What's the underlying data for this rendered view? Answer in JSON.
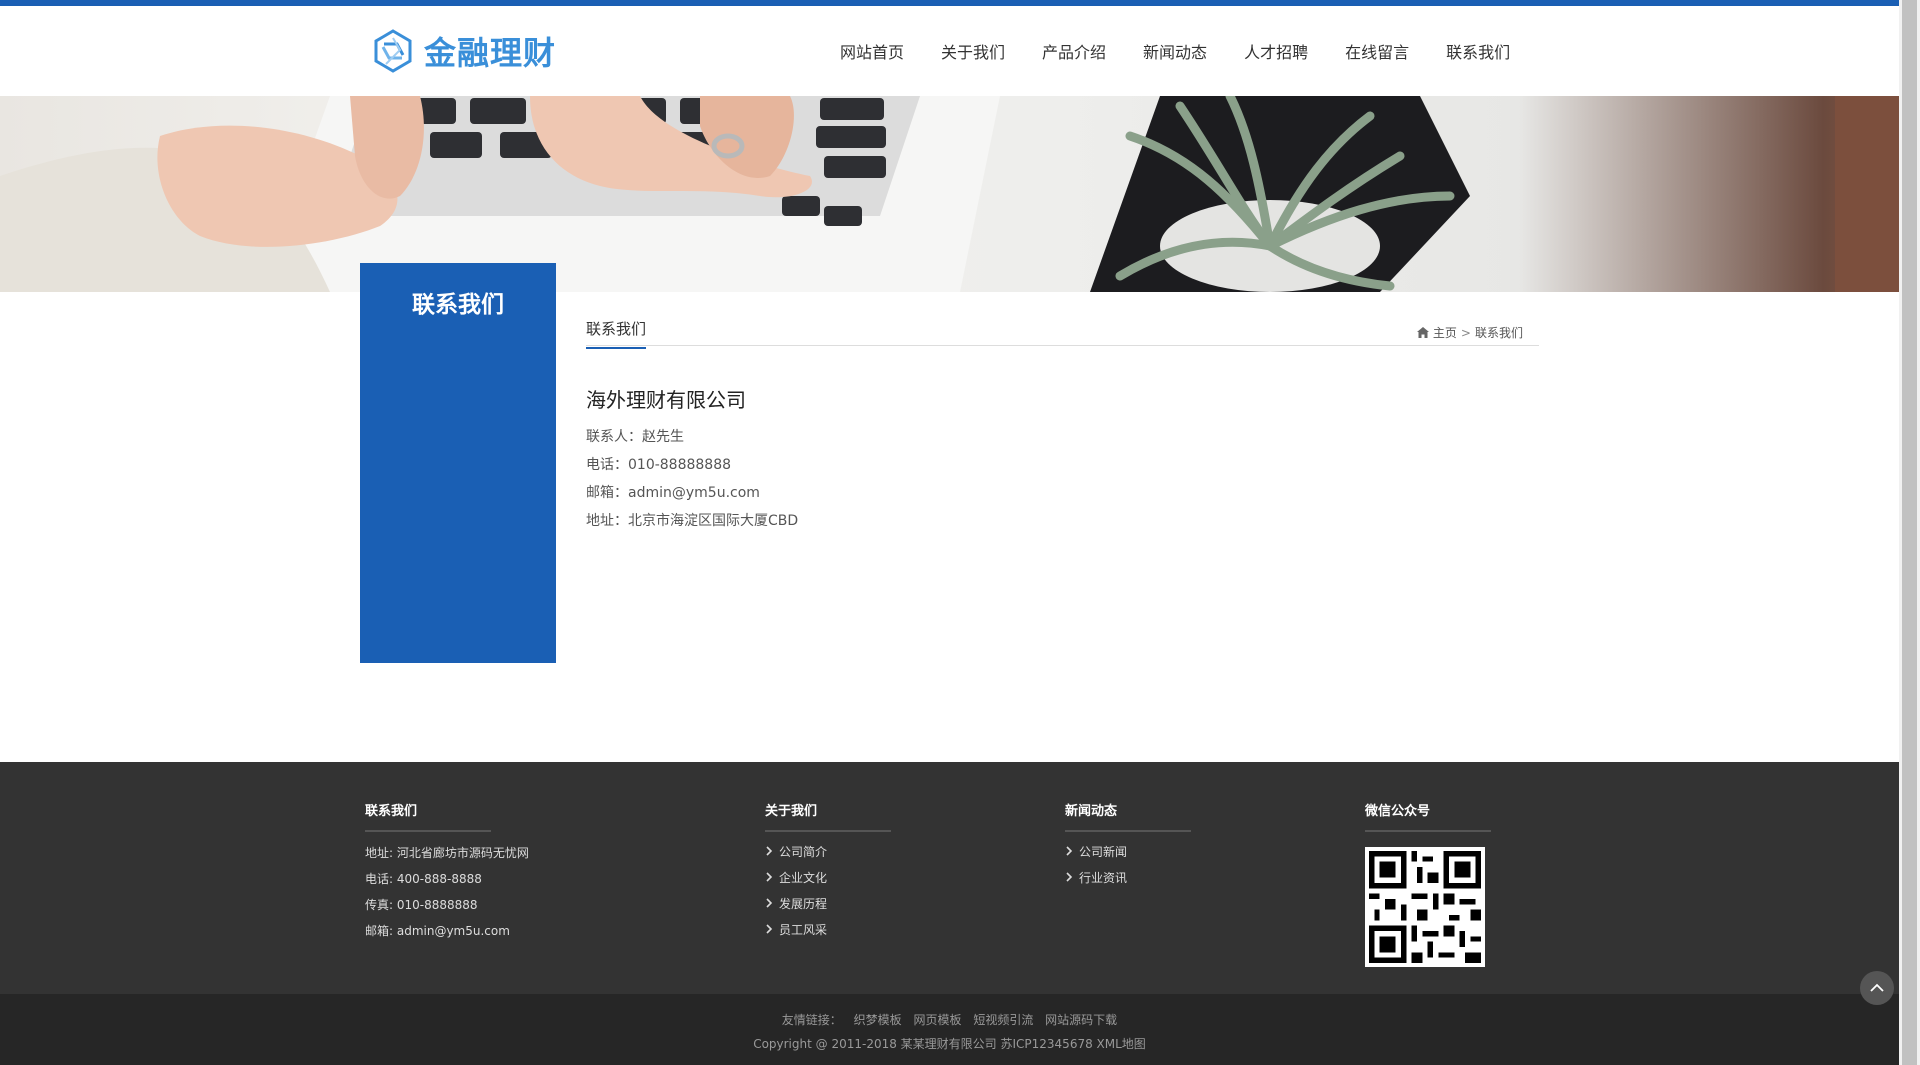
{
  "brand": {
    "name": "金融理财",
    "logo_color": "#3a8fd9",
    "accent": "#1a5fb4"
  },
  "nav": {
    "items": [
      "网站首页",
      "关于我们",
      "产品介绍",
      "新闻动态",
      "人才招聘",
      "在线留言",
      "联系我们"
    ]
  },
  "sidebar": {
    "title": "联系我们"
  },
  "content": {
    "tab": "联系我们",
    "breadcrumb": {
      "home": "主页",
      "sep": ">",
      "current": "联系我们"
    },
    "company": "海外理财有限公司",
    "lines": [
      "联系人：赵先生",
      "电话：010-88888888",
      "邮箱：admin@ym5u.com",
      "地址：北京市海淀区国际大厦CBD"
    ]
  },
  "footer": {
    "contact": {
      "title": "联系我们",
      "lines": [
        "地址: 河北省廊坊市源码无忧网",
        "电话: 400-888-8888",
        "传真: 010-8888888",
        "邮箱: admin@ym5u.com"
      ]
    },
    "about": {
      "title": "关于我们",
      "links": [
        "公司简介",
        "企业文化",
        "发展历程",
        "员工风采"
      ]
    },
    "news": {
      "title": "新闻动态",
      "links": [
        "公司新闻",
        "行业资讯"
      ]
    },
    "wechat": {
      "title": "微信公众号"
    },
    "friend_links": {
      "label": "友情链接：",
      "links": [
        "织梦模板",
        "网页模板",
        "短视频引流",
        "网站源码下载"
      ]
    },
    "copyright": "Copyright @ 2011-2018 某某理财有限公司 苏ICP12345678 XML地图"
  },
  "icons": {
    "home": "home-icon",
    "chevron": "chevron-right-icon",
    "back_to_top": "chevron-up-icon"
  }
}
